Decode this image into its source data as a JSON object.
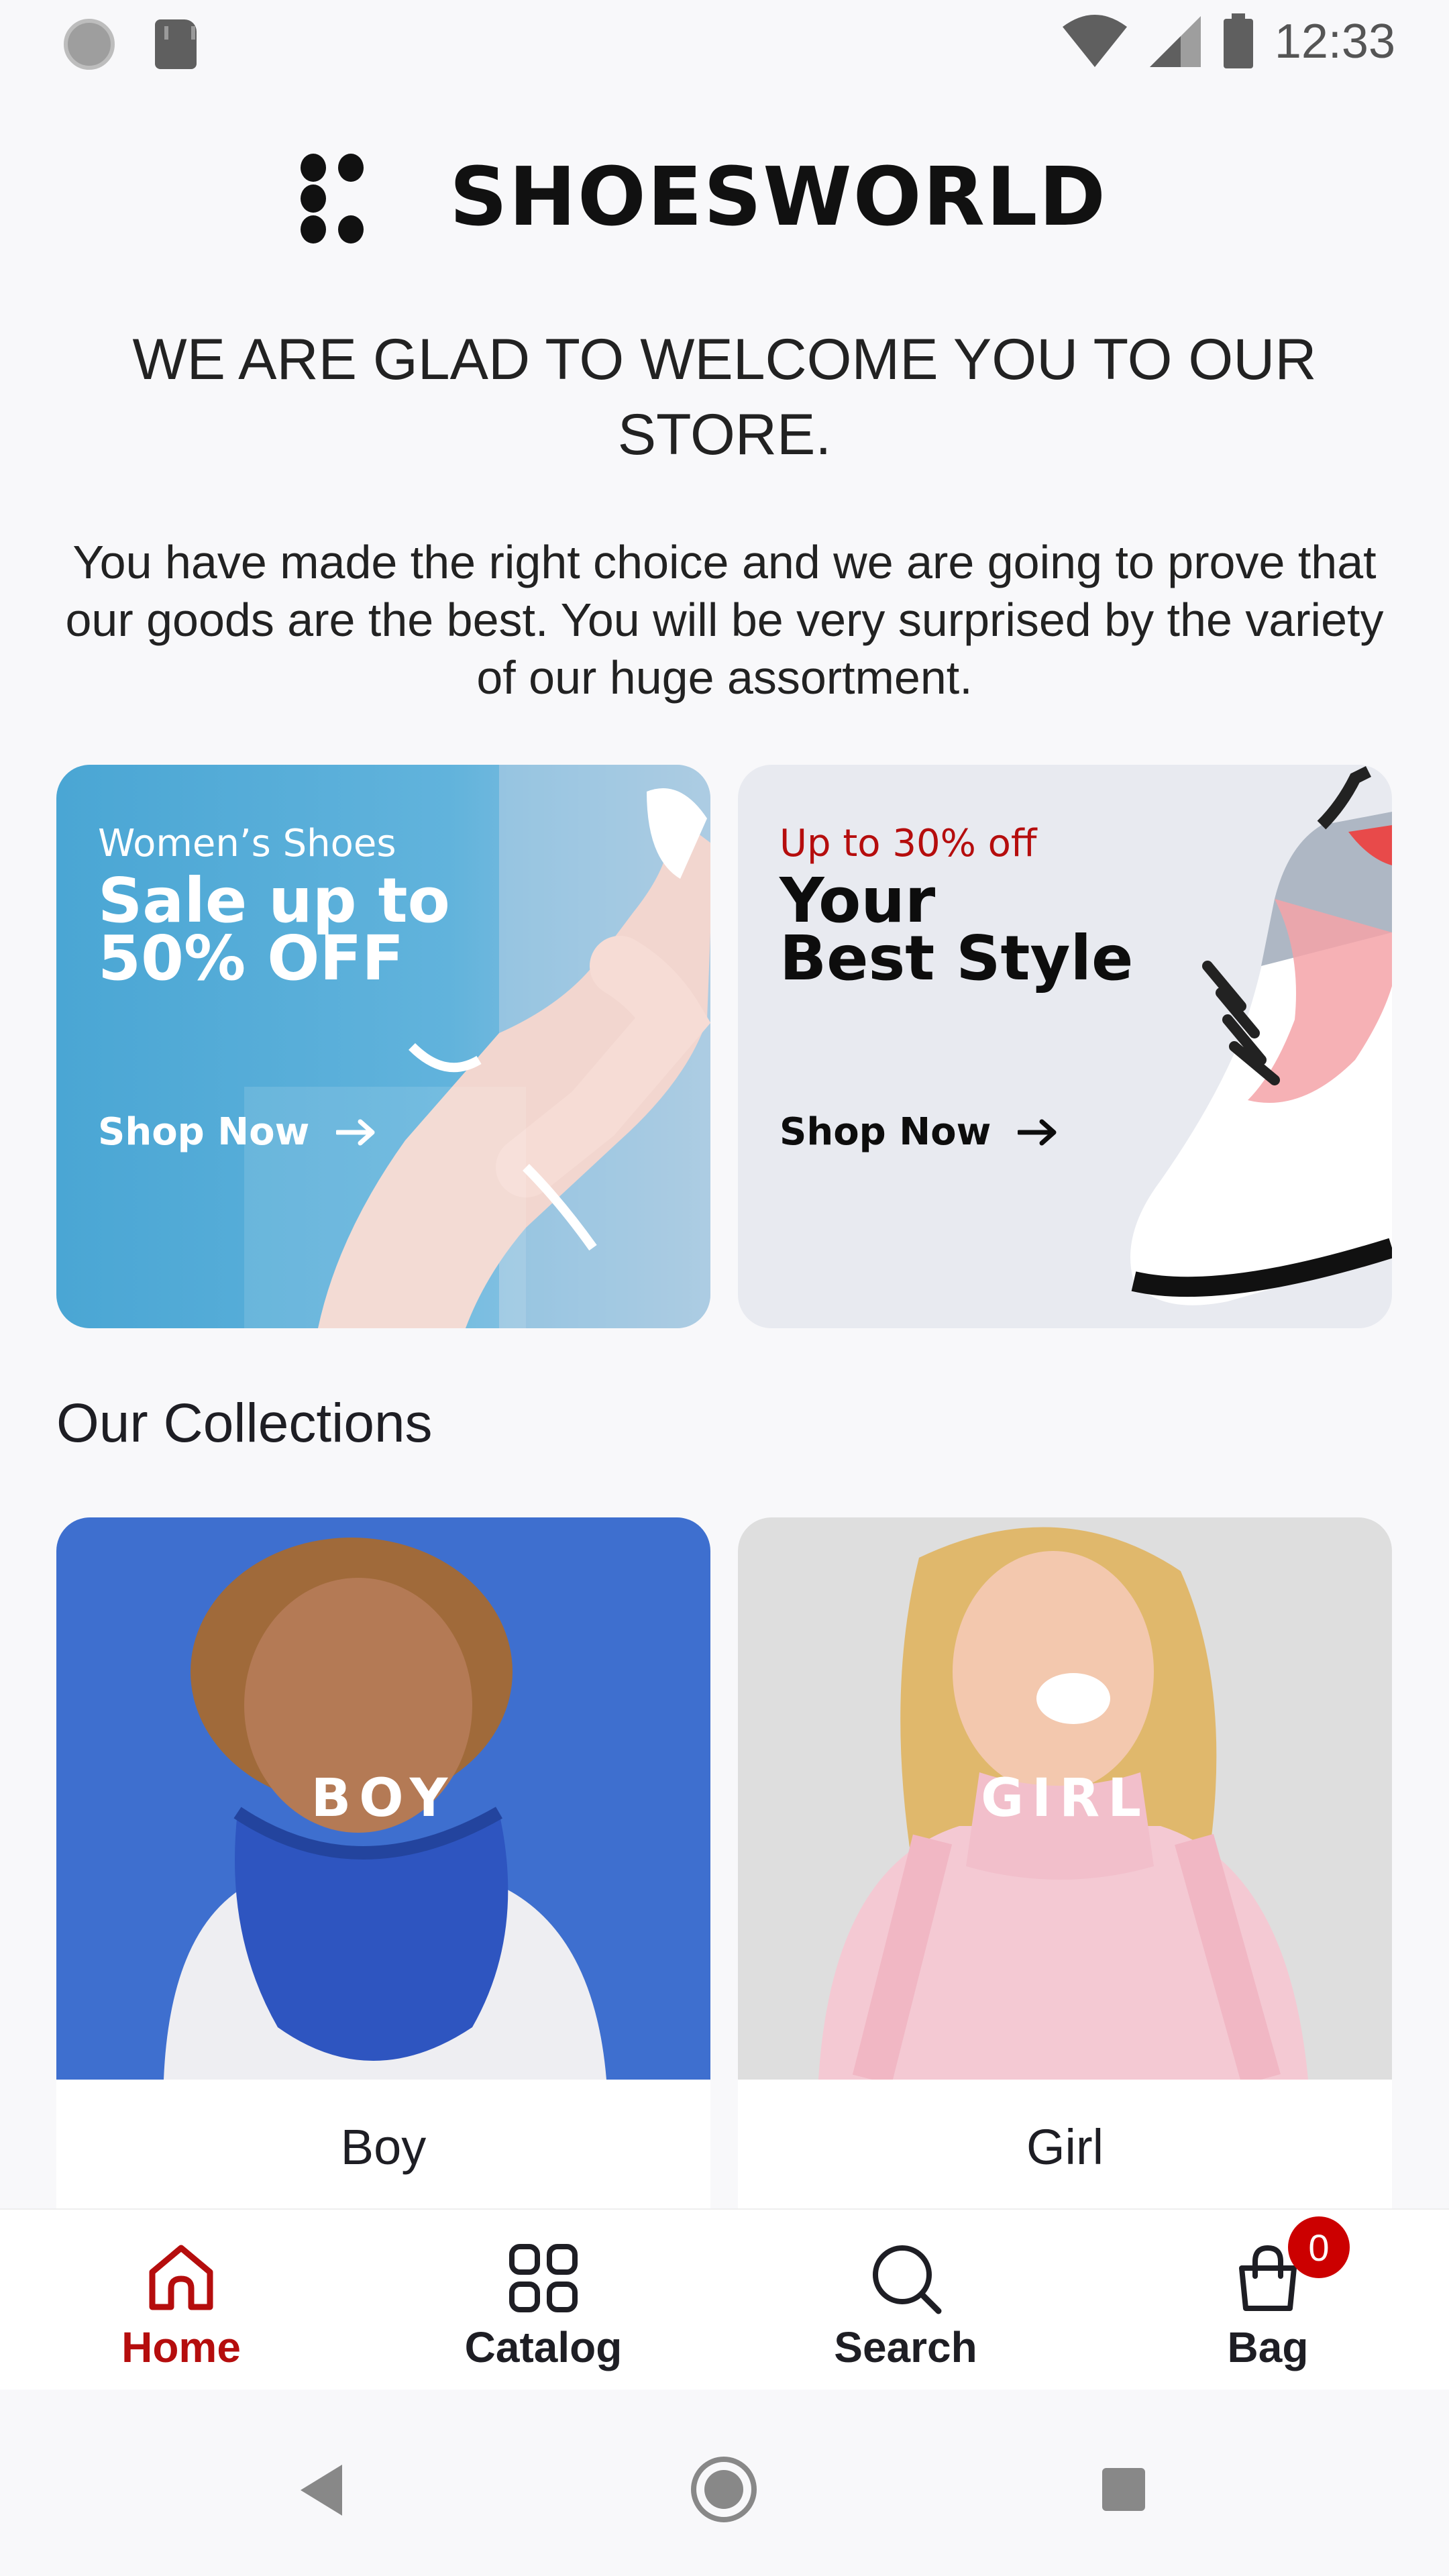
{
  "status_bar": {
    "time": "12:33",
    "icons": [
      "notification-circle-icon",
      "sd-card-icon",
      "wifi-icon",
      "cell-signal-icon",
      "battery-icon"
    ]
  },
  "header": {
    "brand": "SHOESWORLD",
    "welcome": "WE ARE GLAD TO WELCOME YOU TO OUR STORE.",
    "intro": "You have made the right choice and we are going to prove that our goods are the best. You will be very surprised by the variety of our huge assortment."
  },
  "banners": [
    {
      "eyebrow": "Women’s Shoes",
      "title_line1": "Sale up to",
      "title_line2": "50% OFF",
      "cta": "Shop Now"
    },
    {
      "eyebrow": "Up to 30% off",
      "title_line1": "Your",
      "title_line2": "Best Style",
      "cta": "Shop Now"
    }
  ],
  "collections": {
    "title": "Our Collections",
    "items": [
      {
        "overlay": "BOY",
        "caption": "Boy"
      },
      {
        "overlay": "GIRL",
        "caption": "Girl"
      }
    ]
  },
  "bottom_nav": {
    "items": [
      {
        "label": "Home",
        "icon": "home-icon",
        "active": true
      },
      {
        "label": "Catalog",
        "icon": "grid-icon",
        "active": false
      },
      {
        "label": "Search",
        "icon": "search-icon",
        "active": false
      },
      {
        "label": "Bag",
        "icon": "bag-icon",
        "active": false
      }
    ],
    "bag_count": "0"
  },
  "colors": {
    "accent": "#b50d0d",
    "badge": "#cc0000",
    "banner1_bg": "#4aa6d4",
    "banner2_bg": "#e8eaf0",
    "boy_bg": "#3e6fcf",
    "girl_bg": "#dedede"
  }
}
